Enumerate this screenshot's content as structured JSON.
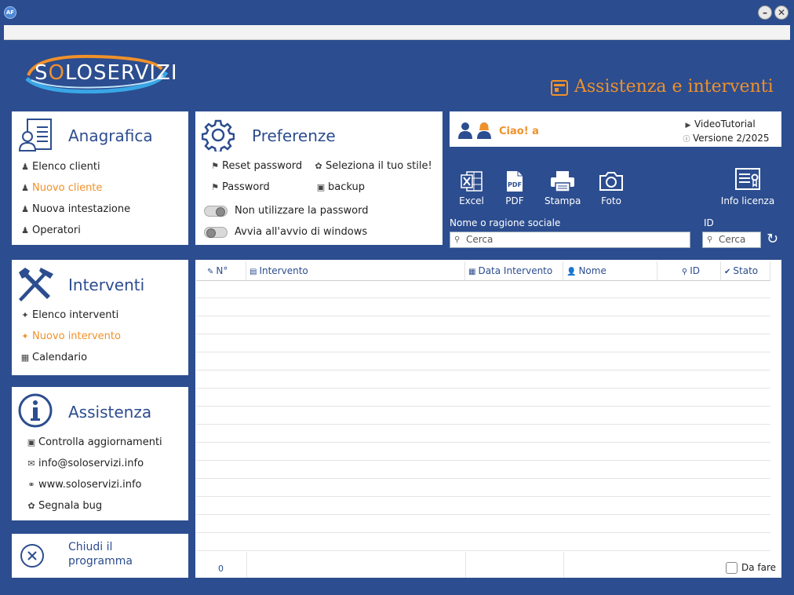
{
  "window": {
    "app_icon": "AF",
    "minimize": "–",
    "close": "✕"
  },
  "header": {
    "logo_prefix": "S",
    "logo_o": "O",
    "logo_rest": "LOSERVIZI",
    "title": "Assistenza e interventi"
  },
  "anagrafica": {
    "title": "Anagrafica",
    "items": [
      {
        "label": "Elenco clienti",
        "icon": "person-icon",
        "glyph": "👤",
        "active": false
      },
      {
        "label": "Nuovo cliente",
        "icon": "person-icon",
        "glyph": "👤",
        "active": true
      },
      {
        "label": "Nuova intestazione",
        "icon": "person-icon",
        "glyph": "👤",
        "active": false
      },
      {
        "label": "Operatori",
        "icon": "person-icon",
        "glyph": "👤",
        "active": false
      }
    ]
  },
  "preferenze": {
    "title": "Preferenze",
    "reset_password": "Reset password",
    "password": "Password",
    "stile": "Seleziona il tuo stile!",
    "backup": "backup",
    "toggle1": {
      "label": "Non utilizzare la password",
      "state": "on"
    },
    "toggle2": {
      "label": "Avvia all'avvio di windows",
      "state": "off"
    }
  },
  "greeting": {
    "text": "Ciao! a",
    "video": "VideoTutorial",
    "version": "Versione 2/2025"
  },
  "toolbar": {
    "excel": "Excel",
    "pdf": "PDF",
    "stampa": "Stampa",
    "foto": "Foto",
    "licenza": "Info licenza"
  },
  "search": {
    "name_label": "Nome o ragione sociale",
    "name_placeholder": "Cerca",
    "id_label": "ID",
    "id_placeholder": "Cerca"
  },
  "interventi": {
    "title": "Interventi",
    "items": [
      {
        "label": "Elenco interventi",
        "active": false
      },
      {
        "label": "Nuovo intervento",
        "active": true
      },
      {
        "label": "Calendario",
        "active": false
      }
    ]
  },
  "assistenza": {
    "title": "Assistenza",
    "items": [
      {
        "label": "Controlla aggiornamenti"
      },
      {
        "label": "info@soloservizi.info"
      },
      {
        "label": "www.soloservizi.info"
      },
      {
        "label": "Segnala bug"
      }
    ]
  },
  "chiudi": {
    "line1": "Chiudi il",
    "line2": "programma"
  },
  "table": {
    "columns": [
      {
        "label": "N°",
        "icon": "✎"
      },
      {
        "label": "Intervento",
        "icon": "▤"
      },
      {
        "label": "Data Intervento",
        "icon": "▦"
      },
      {
        "label": "Nome",
        "icon": "👤"
      },
      {
        "label": "ID",
        "icon": "⚲"
      },
      {
        "label": "Stato",
        "icon": "✔"
      }
    ],
    "count": "0",
    "da_fare": "Da fare"
  }
}
